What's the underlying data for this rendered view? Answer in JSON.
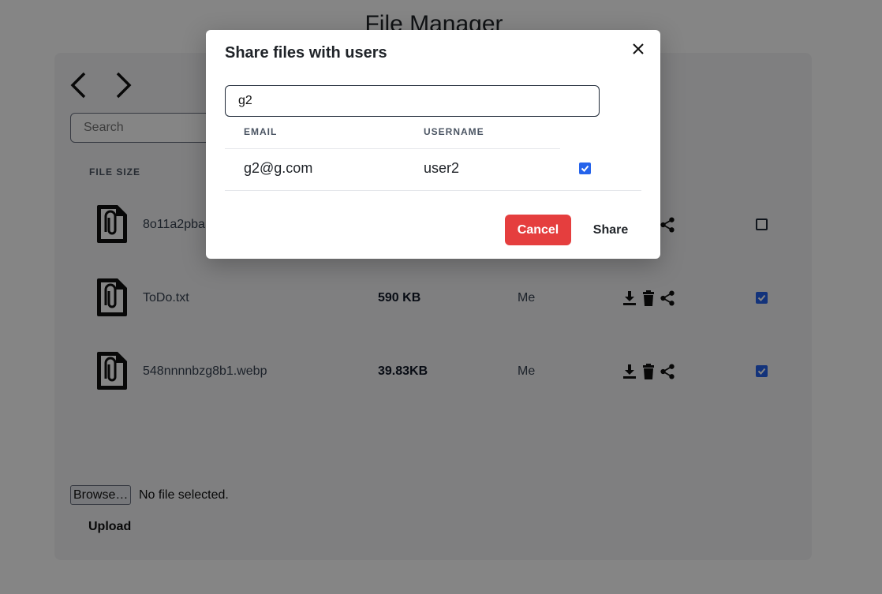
{
  "page": {
    "title": "File Manager"
  },
  "search": {
    "placeholder": "Search"
  },
  "table": {
    "headers": {
      "file_size": "FILE SIZE"
    }
  },
  "files": [
    {
      "name": "8o11a2pba",
      "size": "",
      "owner": "",
      "checked": false
    },
    {
      "name": "ToDo.txt",
      "size": "590 KB",
      "owner": "Me",
      "checked": true
    },
    {
      "name": "548nnnnbzg8b1.webp",
      "size": "39.83KB",
      "owner": "Me",
      "checked": true
    }
  ],
  "upload": {
    "browse_label": "Browse…",
    "no_file_text": "No file selected.",
    "upload_label": "Upload"
  },
  "modal": {
    "title": "Share files with users",
    "search_value": "g2",
    "headers": {
      "email": "EMAIL",
      "username": "USERNAME"
    },
    "rows": [
      {
        "email": "g2@g.com",
        "username": "user2",
        "checked": true
      }
    ],
    "cancel_label": "Cancel",
    "share_label": "Share"
  },
  "colors": {
    "cancel": "#e53e3e",
    "checkbox": "#2563eb",
    "overlay": "rgba(0,0,0,0.48)"
  },
  "icons": [
    "chevron-left-icon",
    "chevron-right-icon",
    "file-attachment-icon",
    "download-icon",
    "trash-icon",
    "share-icon",
    "close-icon",
    "check-icon"
  ]
}
